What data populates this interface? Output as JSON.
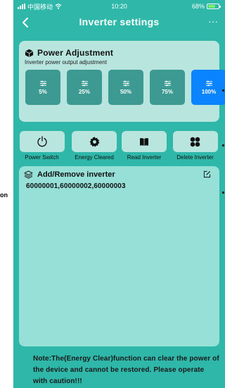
{
  "status_bar": {
    "carrier": "中国移动",
    "time": "10:20",
    "battery": "68%",
    "battery_level": 0.68
  },
  "nav": {
    "title": "Inverter settings",
    "back_icon": "chevron-left-icon",
    "more_icon": "more-dots-icon",
    "more_label": "···"
  },
  "power": {
    "title": "Power Adjustment",
    "subtitle": "Inverter power output adjustment",
    "icon": "cube-icon",
    "levels": [
      {
        "label": "5%",
        "active": false
      },
      {
        "label": "25%",
        "active": false
      },
      {
        "label": "50%",
        "active": false
      },
      {
        "label": "75%",
        "active": false
      },
      {
        "label": "100%",
        "active": true
      }
    ]
  },
  "actions": {
    "power_switch": "Power Switch",
    "energy_cleared": "Energy Cleared",
    "read_inverter": "Read Inverter",
    "delete_inverter": "Delete Inverter"
  },
  "inverters": {
    "title": "Add/Remove inverter",
    "list": "60000001,60000002,60000003"
  },
  "note": {
    "text": "Note:The(Energy Clear)function can clear the power of the device and cannot be restored. Please operate with caution!!!"
  },
  "background": {
    "edge_text": "on"
  },
  "colors": {
    "background": "#2fb8aa",
    "card": "#b8e5de",
    "list_card": "#96e0d8",
    "power_button": "#3d9a92",
    "power_button_active": "#0a84ff"
  }
}
